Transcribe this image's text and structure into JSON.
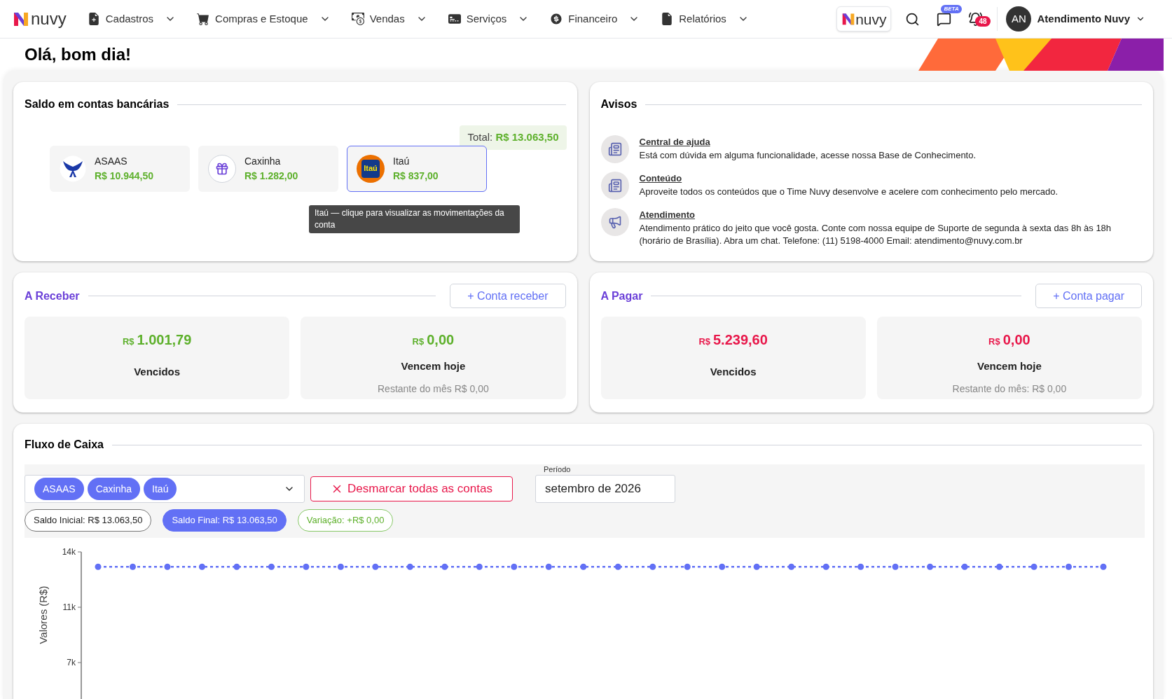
{
  "nav": {
    "brand": "nuvy",
    "menu": [
      {
        "label": "Cadastros"
      },
      {
        "label": "Compras e Estoque"
      },
      {
        "label": "Vendas"
      },
      {
        "label": "Serviços"
      },
      {
        "label": "Financeiro"
      },
      {
        "label": "Relatórios"
      }
    ],
    "partner_brand": "nuvy",
    "chat_badge": "BETA",
    "notification_count": "48",
    "user": {
      "initials": "AN",
      "name": "Atendimento Nuvy"
    }
  },
  "greeting": "Olá, bom dia!",
  "balances": {
    "title": "Saldo em contas bancárias",
    "total_label": "Total:",
    "total": "R$ 13.063,50",
    "accounts": [
      {
        "name": "ASAAS",
        "amount": "R$ 10.944,50",
        "kind": "wings",
        "selected": false
      },
      {
        "name": "Caxinha",
        "amount": "R$ 1.282,00",
        "kind": "gift",
        "selected": false
      },
      {
        "name": "Itaú",
        "amount": "R$ 837,00",
        "kind": "bank",
        "logo_text": "Itaú",
        "selected": true
      }
    ],
    "tooltip": "Itaú — clique para visualizar as movimentações da conta"
  },
  "notices": {
    "title": "Avisos",
    "items": [
      {
        "title": "Central de ajuda",
        "text": "Está com dúvida em alguma funcionalidade, acesse nossa Base de Conhecimento.",
        "kind": "news"
      },
      {
        "title": "Conteúdo",
        "text": "Aproveite todos os conteúdos que o Time Nuvy desenvolve e acelere com conhecimento pelo mercado.",
        "kind": "news"
      },
      {
        "title": "Atendimento",
        "text": "Atendimento prático do jeito que você gosta. Conte com nossa equipe de Suporte de segunda à sexta das 8h às 18h (horário de Brasília). Abra um chat. Telefone: (11) 5198-4000 Email: atendimento@nuvy.com.br",
        "kind": "megaphone"
      }
    ]
  },
  "summaries": [
    {
      "title": "A Receber",
      "button": "+ Conta receber",
      "color": "#5db02b",
      "boxes": [
        {
          "currency": "R$",
          "amount": "1.001,79",
          "label": "Vencidos"
        },
        {
          "currency": "R$",
          "amount": "0,00",
          "label": "Vencem hoje",
          "note": "Restante do mês R$ 0,00"
        }
      ]
    },
    {
      "title": "A Pagar",
      "button": "+ Conta pagar",
      "color": "#e8174a",
      "boxes": [
        {
          "currency": "R$",
          "amount": "5.239,60",
          "label": "Vencidos"
        },
        {
          "currency": "R$",
          "amount": "0,00",
          "label": "Vencem hoje",
          "note": "Restante do mês: R$ 0,00"
        }
      ]
    }
  ],
  "cashflow": {
    "title": "Fluxo de Caixa",
    "accounts": [
      "ASAAS",
      "Caxinha",
      "Itaú"
    ],
    "clear_button": "Desmarcar todas as contas",
    "period": {
      "label": "Período",
      "value": "setembro de 2026"
    },
    "summary": [
      {
        "label": "Saldo Inicial: R$ 13.063,50",
        "kind": "outline"
      },
      {
        "label": "Saldo Final: R$ 13.063,50",
        "kind": "filled"
      },
      {
        "label": "Variação: +R$ 0,00",
        "kind": "positive"
      }
    ],
    "chart_data": {
      "type": "line",
      "ylabel": "Valores (R$)",
      "ylim": [
        3500,
        14000
      ],
      "yticks": [
        {
          "value": 7000,
          "label": "7k"
        },
        {
          "value": 10500,
          "label": "11k"
        },
        {
          "value": 14000,
          "label": "14k"
        }
      ],
      "series": [
        {
          "color": "#6270f5",
          "line_style": "dashed",
          "marker": "circle",
          "values": [
            13060,
            13060,
            13060,
            13060,
            13060,
            13060,
            13060,
            13060,
            13060,
            13060,
            13060,
            13060,
            13060,
            13060,
            13060,
            13060,
            13060,
            13060,
            13060,
            13060,
            13060,
            13060,
            13060,
            13060,
            13060,
            13060,
            13060,
            13060,
            13060,
            13060
          ]
        }
      ]
    }
  }
}
